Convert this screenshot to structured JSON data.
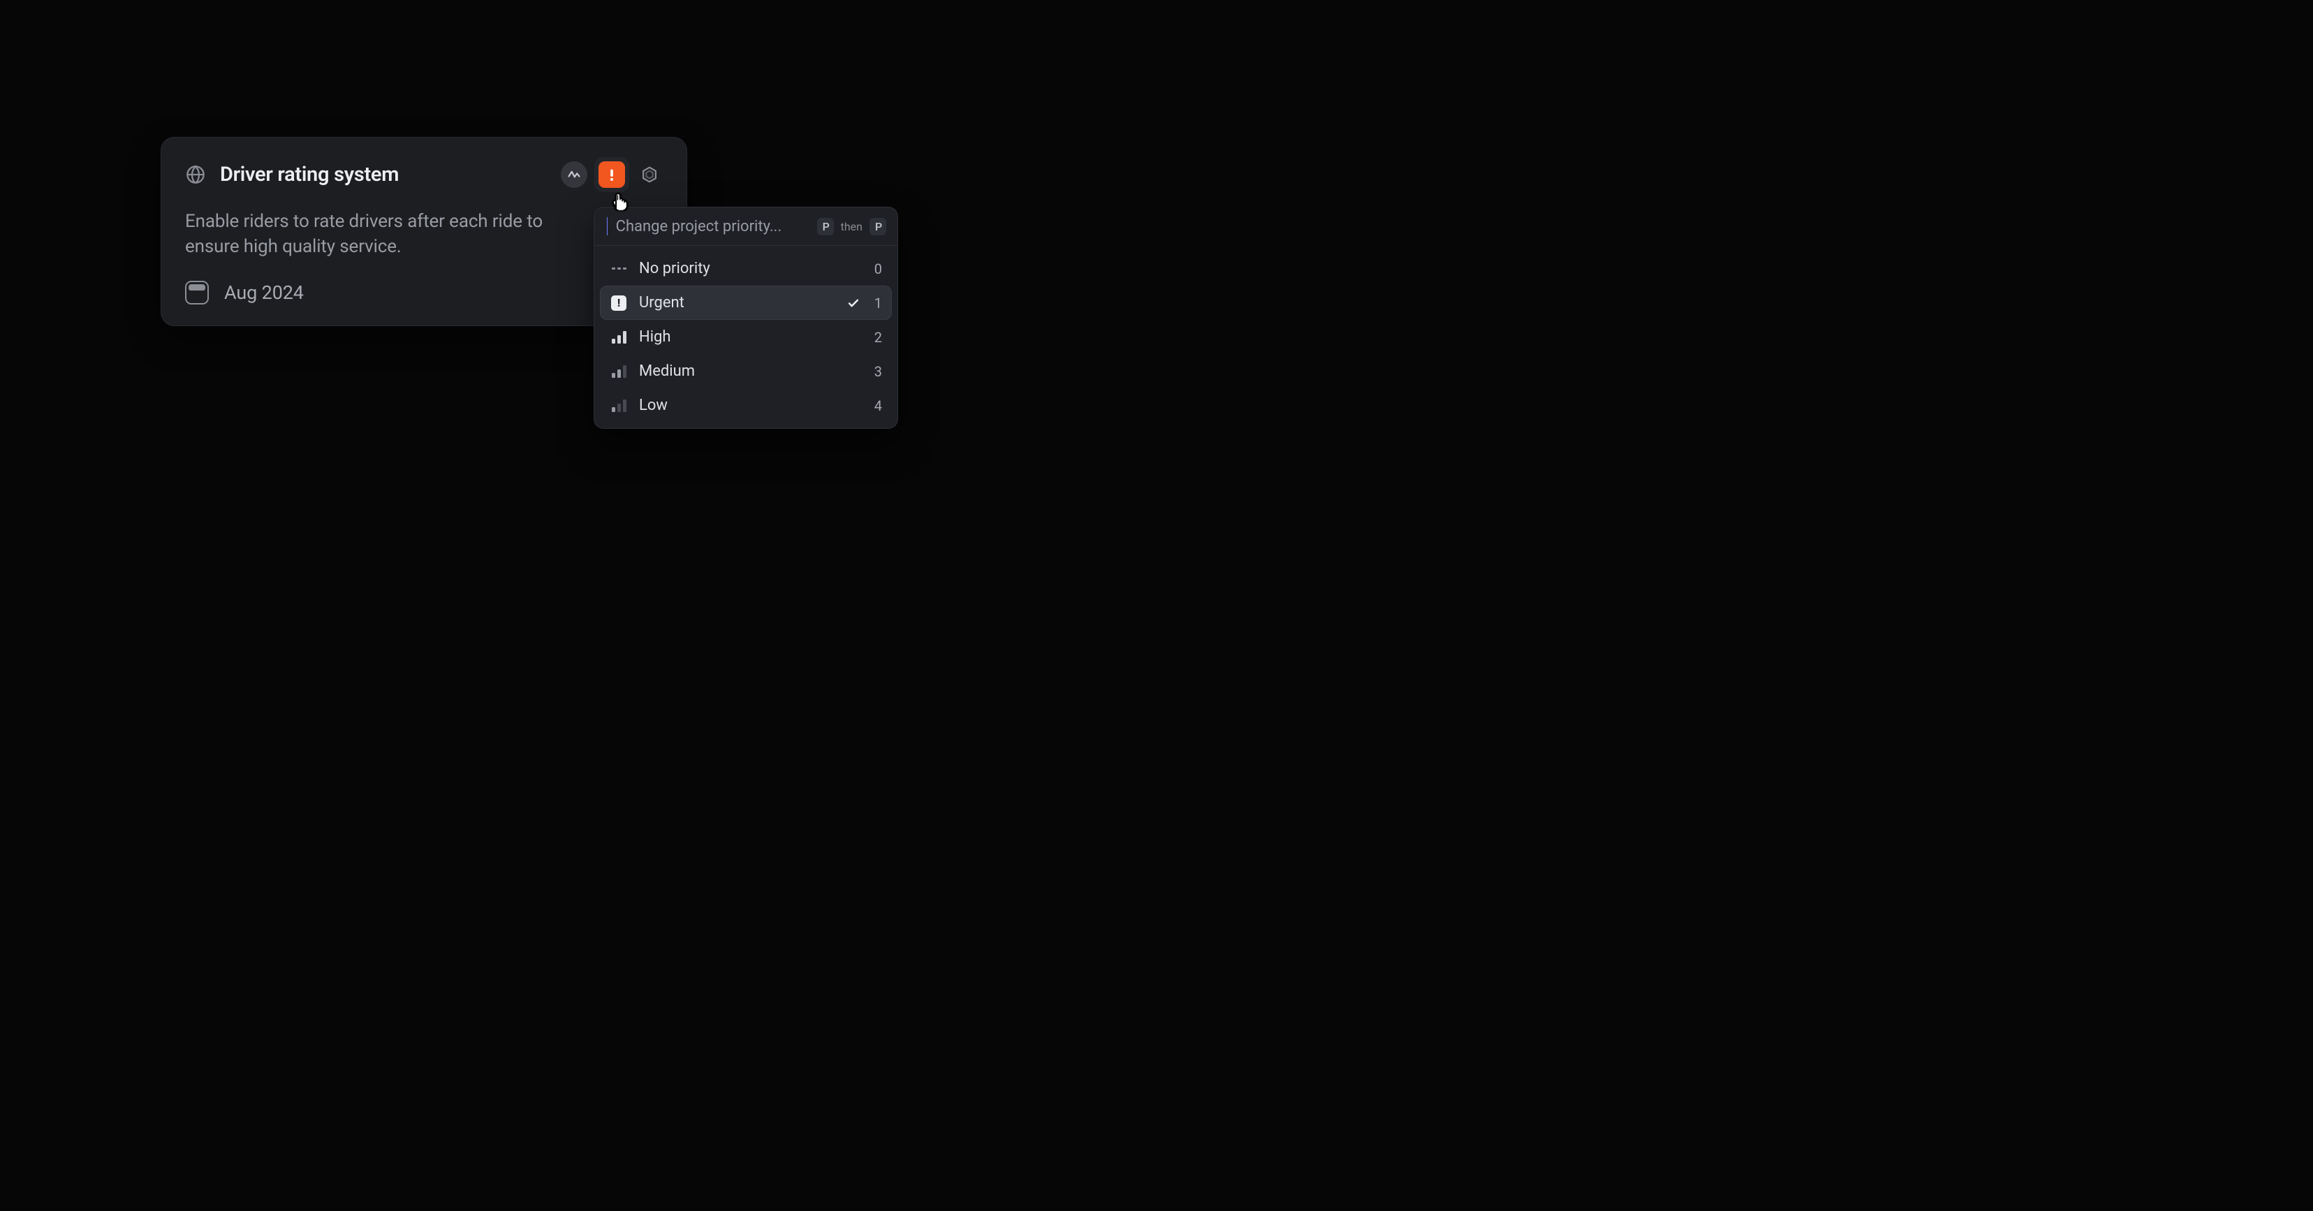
{
  "card": {
    "title": "Driver rating system",
    "description": "Enable riders to rate drivers after each ride to ensure high quality service.",
    "date": "Aug 2024"
  },
  "menu": {
    "placeholder": "Change project priority...",
    "kbd1": "P",
    "kbd_sep": "then",
    "kbd2": "P",
    "items": [
      {
        "label": "No priority",
        "shortcut": "0"
      },
      {
        "label": "Urgent",
        "shortcut": "1"
      },
      {
        "label": "High",
        "shortcut": "2"
      },
      {
        "label": "Medium",
        "shortcut": "3"
      },
      {
        "label": "Low",
        "shortcut": "4"
      }
    ]
  }
}
